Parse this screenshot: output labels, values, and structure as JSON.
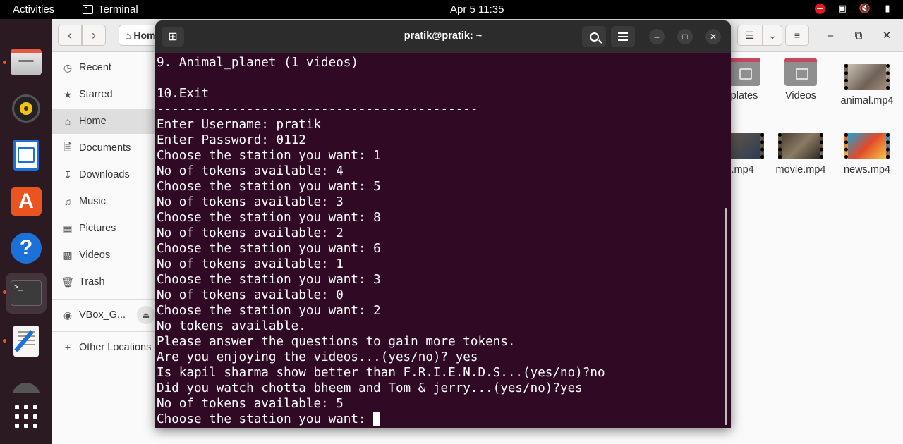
{
  "topbar": {
    "activities": "Activities",
    "app_name": "Terminal",
    "clock": "Apr 5  11:35"
  },
  "files": {
    "path_label": "Home",
    "sidebar": {
      "items": [
        {
          "label": "Recent",
          "icon": "clock-icon"
        },
        {
          "label": "Starred",
          "icon": "star-icon"
        },
        {
          "label": "Home",
          "icon": "home-icon"
        },
        {
          "label": "Documents",
          "icon": "document-icon"
        },
        {
          "label": "Downloads",
          "icon": "download-icon"
        },
        {
          "label": "Music",
          "icon": "music-icon"
        },
        {
          "label": "Pictures",
          "icon": "picture-icon"
        },
        {
          "label": "Videos",
          "icon": "video-icon"
        },
        {
          "label": "Trash",
          "icon": "trash-icon"
        }
      ],
      "device": "VBox_G...",
      "other_locations": "Other Locations"
    },
    "grid": {
      "templates_label": "plates",
      "videos_label": "Videos",
      "animal_label": "animal.mp4",
      "partial_label": "l.mp4",
      "movie_label": "movie.mp4",
      "news_label": "news.mp4"
    }
  },
  "terminal": {
    "title": "pratik@pratik: ~",
    "lines": [
      "9. Animal_planet (1 videos)",
      "",
      "10.Exit",
      "-------------------------------------------",
      "Enter Username: pratik",
      "Enter Password: 0112",
      "Choose the station you want: 1",
      "No of tokens available: 4",
      "Choose the station you want: 5",
      "No of tokens available: 3",
      "Choose the station you want: 8",
      "No of tokens available: 2",
      "Choose the station you want: 6",
      "No of tokens available: 1",
      "Choose the station you want: 3",
      "No of tokens available: 0",
      "Choose the station you want: 2",
      "No tokens available.",
      "Please answer the questions to gain more tokens.",
      "Are you enjoying the videos...(yes/no)? yes",
      "Is kapil sharma show better than F.R.I.E.N.D.S...(yes/no)?no",
      "Did you watch chotta bheem and Tom & jerry...(yes/no)?yes",
      "No of tokens available: 5"
    ],
    "prompt": "Choose the station you want: "
  }
}
